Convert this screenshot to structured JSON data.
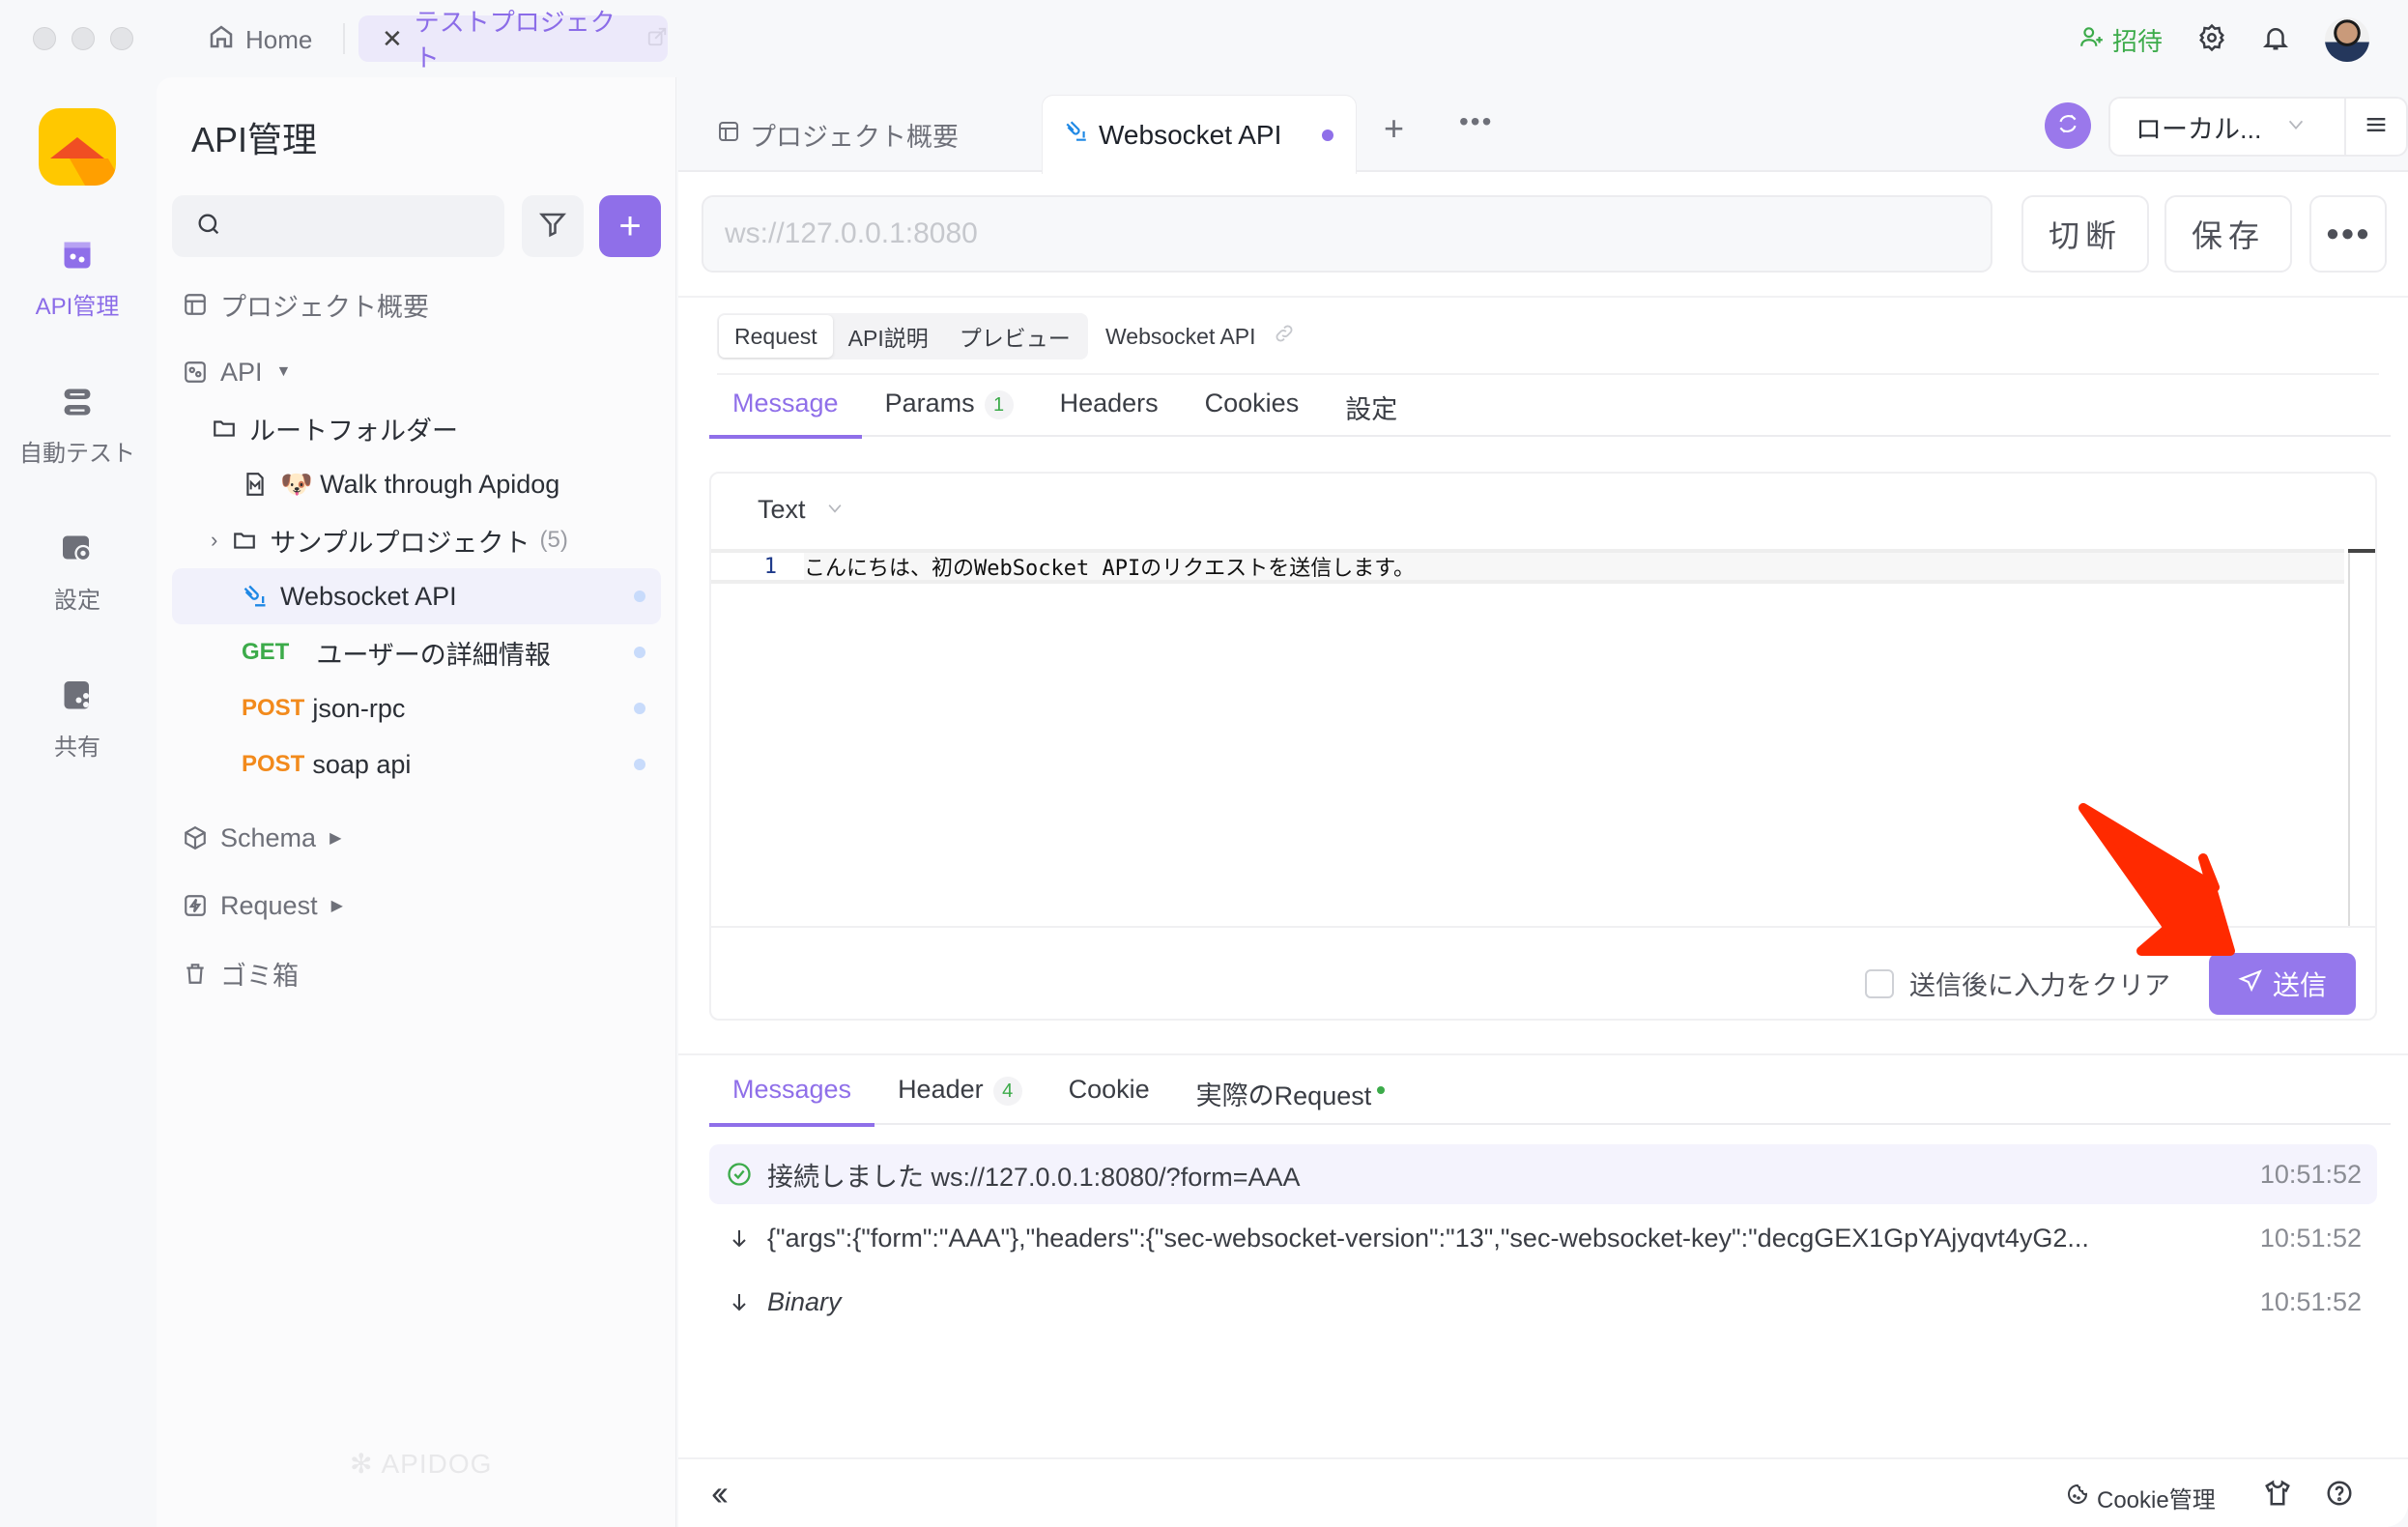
{
  "titlebar": {
    "home_label": "Home",
    "project_tab": "テストプロジェクト",
    "invite_label": "招待"
  },
  "rail": {
    "items": [
      {
        "label": "API管理",
        "icon": "api-icon",
        "active": true
      },
      {
        "label": "自動テスト",
        "icon": "automation-icon",
        "active": false
      },
      {
        "label": "設定",
        "icon": "settings-icon",
        "active": false
      },
      {
        "label": "共有",
        "icon": "share-icon",
        "active": false
      }
    ]
  },
  "sidebar": {
    "title": "API管理",
    "search_placeholder": "",
    "tree": {
      "overview": "プロジェクト概要",
      "api": "API",
      "root_folder": "ルートフォルダー",
      "walkthrough": "🐶 Walk through Apidog",
      "sample_project": "サンプルプロジェクト",
      "sample_count": "(5)",
      "websocket": "Websocket API",
      "endpoints": [
        {
          "method": "GET",
          "name": "ユーザーの詳細情報"
        },
        {
          "method": "POST",
          "name": "json-rpc"
        },
        {
          "method": "POST",
          "name": "soap api"
        }
      ],
      "schema": "Schema",
      "request": "Request",
      "trash": "ゴミ箱"
    },
    "watermark": "APIDOG"
  },
  "main": {
    "tabs": [
      {
        "label": "プロジェクト概要",
        "active": false
      },
      {
        "label": "Websocket API",
        "active": true
      }
    ],
    "environment": "ローカル...",
    "url_placeholder": "ws://127.0.0.1:8080",
    "disconnect_label": "切断",
    "save_label": "保存",
    "seg_tabs": [
      "Request",
      "API説明",
      "プレビュー"
    ],
    "crumb_name": "Websocket API",
    "request_tabs": [
      {
        "label": "Message",
        "badge": null,
        "active": true
      },
      {
        "label": "Params",
        "badge": "1",
        "active": false
      },
      {
        "label": "Headers",
        "badge": null,
        "active": false
      },
      {
        "label": "Cookies",
        "badge": null,
        "active": false
      },
      {
        "label": "設定",
        "badge": null,
        "active": false
      }
    ],
    "editor": {
      "format": "Text",
      "line_number": "1",
      "content": "こんにちは、初のWebSocket APIのリクエストを送信します。"
    },
    "clear_after_send_label": "送信後に入力をクリア",
    "clear_after_send_checked": false,
    "send_label": "送信",
    "response_tabs": [
      {
        "label": "Messages",
        "badge": null,
        "active": true
      },
      {
        "label": "Header",
        "badge": "4",
        "active": false
      },
      {
        "label": "Cookie",
        "badge": null,
        "active": false
      },
      {
        "label": "実際のRequest",
        "badge": null,
        "active": false
      }
    ],
    "messages": [
      {
        "type": "connected",
        "text": "接続しました ws://127.0.0.1:8080/?form=AAA",
        "time": "10:51:52"
      },
      {
        "type": "received",
        "text": "{\"args\":{\"form\":\"AAA\"},\"headers\":{\"sec-websocket-version\":\"13\",\"sec-websocket-key\":\"decgGEX1GpYAjyqvt4yG2...",
        "time": "10:51:52"
      },
      {
        "type": "received",
        "text": "Binary",
        "time": "10:51:52"
      }
    ],
    "footer": {
      "cookie_manager": "Cookie管理"
    }
  },
  "colors": {
    "accent": "#8f6fe9",
    "get": "#3cab4a",
    "post": "#f28a1c",
    "annotation_arrow": "#ff2a00"
  }
}
